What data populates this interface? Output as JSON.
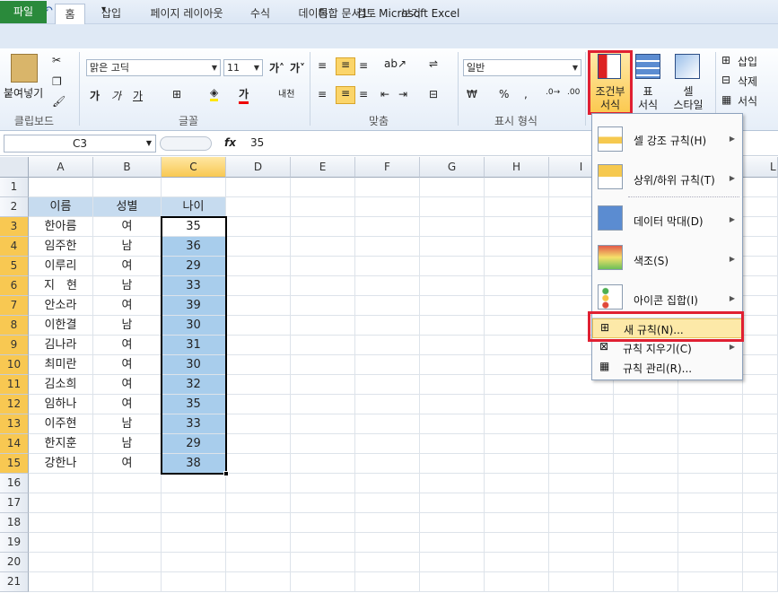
{
  "window": {
    "title": "통합 문서1 - Microsoft Excel"
  },
  "tabs": [
    "파일",
    "홈",
    "삽입",
    "페이지 레이아웃",
    "수식",
    "데이터",
    "검토",
    "보기"
  ],
  "ribbon": {
    "paste": "붙여넣기",
    "font_name": "맑은 고딕",
    "font_size": "11",
    "number_format": "일반",
    "percent": "%",
    "comma": ",",
    "cond_format_line1": "조건부",
    "cond_format_line2": "서식",
    "table_line1": "표",
    "table_line2": "서식",
    "cell_style_line1": "셀",
    "cell_style_line2": "스타일",
    "insert": "삽입",
    "delete": "삭제",
    "format": "서식",
    "groups": {
      "clipboard": "클립보드",
      "font": "글꼴",
      "align": "맞춤",
      "number": "표시 형식"
    }
  },
  "formula_bar": {
    "name_box": "C3",
    "fx": "fx",
    "value": "35"
  },
  "columns": [
    "A",
    "B",
    "C",
    "D",
    "E",
    "F",
    "G",
    "H",
    "I",
    "L"
  ],
  "rows": [
    "1",
    "2",
    "3",
    "4",
    "5",
    "6",
    "7",
    "8",
    "9",
    "10",
    "11",
    "12",
    "13",
    "14",
    "15",
    "16",
    "17",
    "18",
    "19",
    "20",
    "21"
  ],
  "table": {
    "headers": [
      "이름",
      "성별",
      "나이"
    ],
    "data": [
      [
        "한아름",
        "여",
        "35"
      ],
      [
        "임주한",
        "남",
        "36"
      ],
      [
        "이루리",
        "여",
        "29"
      ],
      [
        "지　현",
        "남",
        "33"
      ],
      [
        "안소라",
        "여",
        "39"
      ],
      [
        "이한결",
        "남",
        "30"
      ],
      [
        "김나라",
        "여",
        "31"
      ],
      [
        "최미란",
        "여",
        "30"
      ],
      [
        "김소희",
        "여",
        "32"
      ],
      [
        "임하나",
        "여",
        "35"
      ],
      [
        "이주현",
        "남",
        "33"
      ],
      [
        "한지훈",
        "남",
        "29"
      ],
      [
        "강한나",
        "여",
        "38"
      ]
    ]
  },
  "menu": {
    "items": [
      {
        "label": "셀 강조 규칙(H)",
        "icon": "highlight-rules-icon"
      },
      {
        "label": "상위/하위 규칙(T)",
        "icon": "top-bottom-rules-icon"
      },
      {
        "label": "데이터 막대(D)",
        "icon": "data-bars-icon"
      },
      {
        "label": "색조(S)",
        "icon": "color-scales-icon"
      },
      {
        "label": "아이콘 집합(I)",
        "icon": "icon-sets-icon"
      }
    ],
    "new_rule": "새 규칙(N)...",
    "clear_rules": "규칙 지우기(C)",
    "manage_rules": "규칙 관리(R)..."
  }
}
